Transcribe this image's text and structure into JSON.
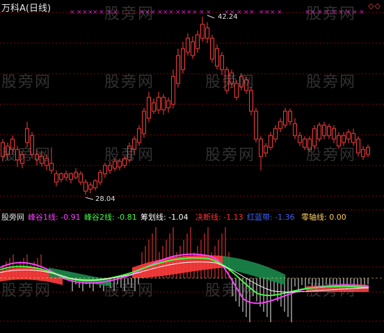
{
  "header": {
    "title": "万科A(日线)",
    "corner_icons": "◇◇"
  },
  "price_panel": {
    "high_label": "42.24",
    "low_label": "28.04"
  },
  "indicator_bar": {
    "items": [
      {
        "text": "股旁网",
        "color": "#e0e0e0"
      },
      {
        "text": "峰谷1线: -0.91",
        "color": "#ff40ff"
      },
      {
        "text": "峰谷2线: -0.81",
        "color": "#40ff40"
      },
      {
        "text": "筹划线: -1.04",
        "color": "#ffffff"
      },
      {
        "text": "决断线: -1.13",
        "color": "#ff3030"
      },
      {
        "text": "红蓝带: -1.36",
        "color": "#4060ff"
      },
      {
        "text": "零轴线: 0.00",
        "color": "#ffd060"
      }
    ]
  },
  "watermark": "股旁网",
  "colors": {
    "up": "#ff3c3c",
    "down": "#4ff0f0",
    "grid": "#8b0000",
    "marker": "#d020d0"
  }
}
